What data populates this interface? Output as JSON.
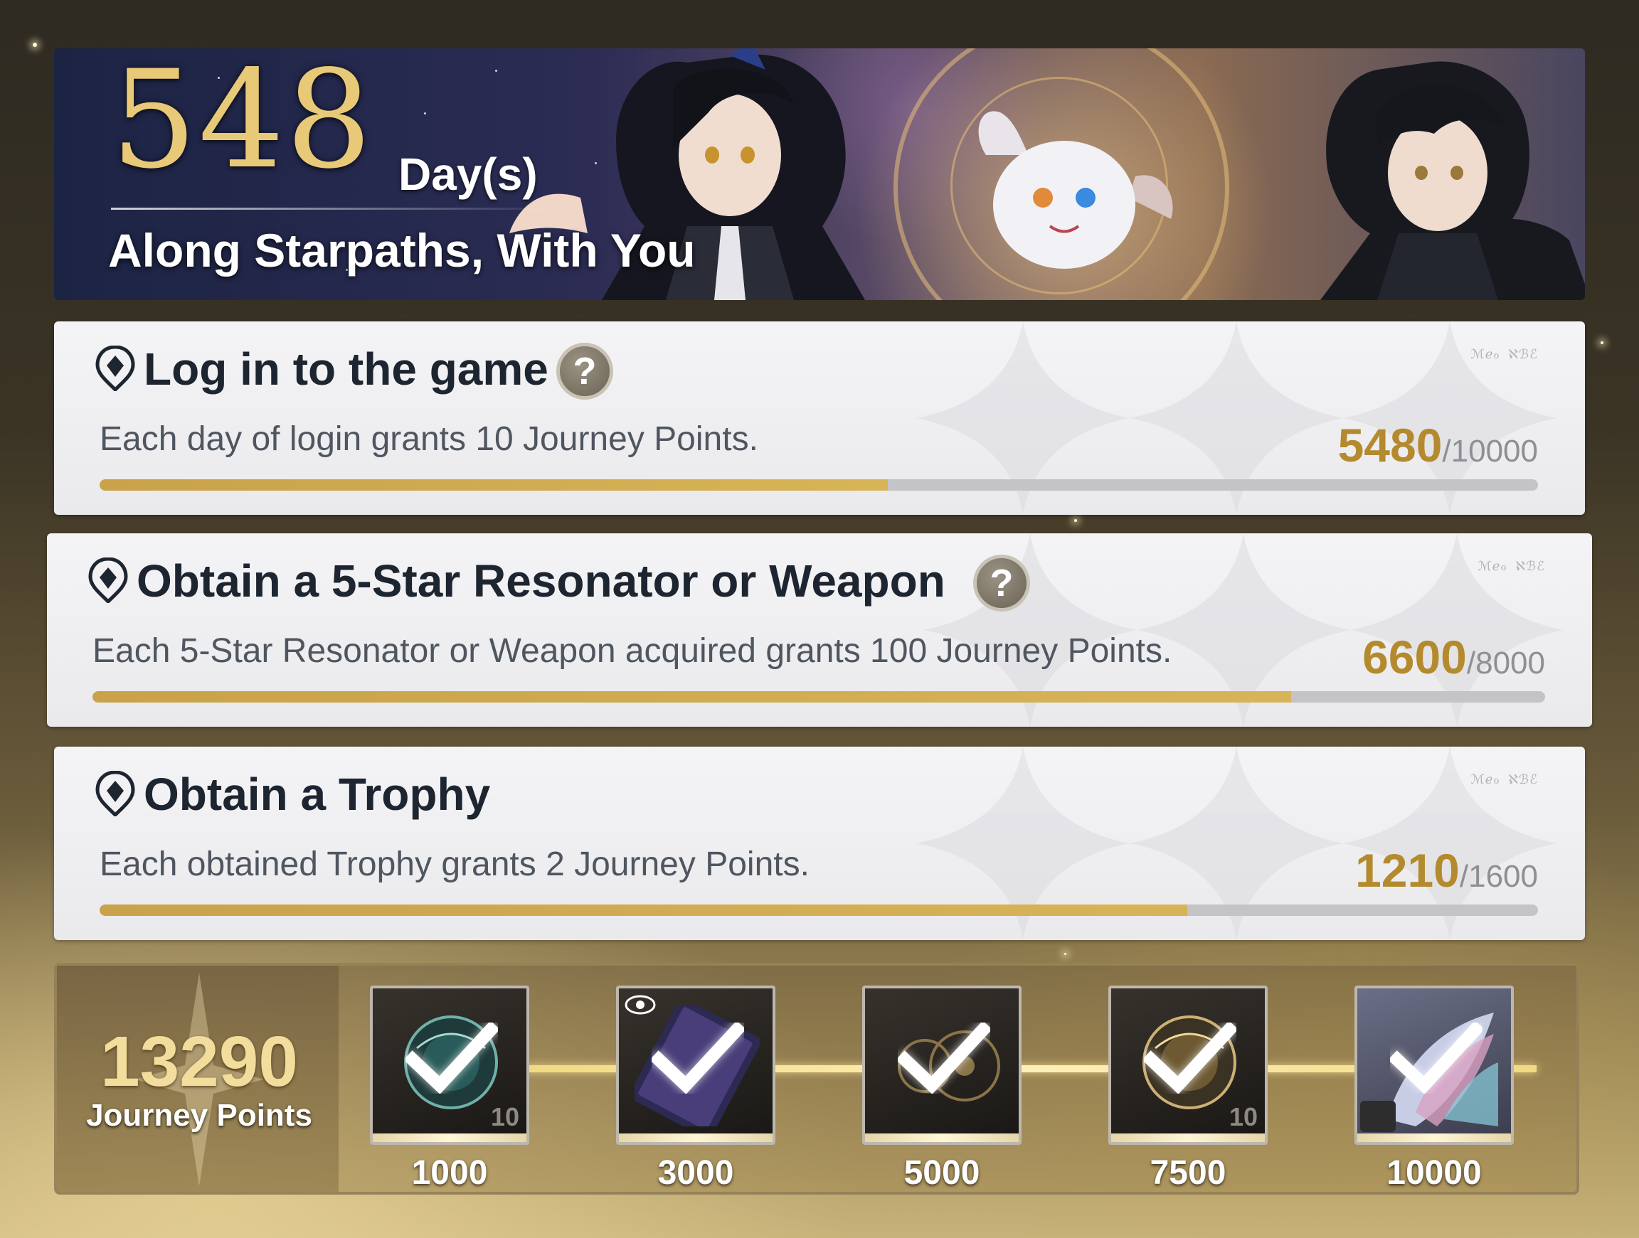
{
  "banner": {
    "days_number": "548",
    "days_unit": "Day(s)",
    "tagline": "Along Starpaths, With You"
  },
  "tasks": [
    {
      "title": "Log in to the game",
      "has_help": true,
      "description": "Each day of login grants 10 Journey Points.",
      "current": "5480",
      "total": "/10000",
      "progress": 0.548
    },
    {
      "title": "Obtain a 5-Star Resonator or Weapon",
      "has_help": true,
      "description": "Each 5-Star Resonator or Weapon acquired grants 100 Journey Points.",
      "current": "6600",
      "total": "/8000",
      "progress": 0.825
    },
    {
      "title": "Obtain a Trophy",
      "has_help": false,
      "description": "Each obtained Trophy grants 2 Journey Points.",
      "current": "1210",
      "total": "/1600",
      "progress": 0.756
    }
  ],
  "rewards": {
    "total_points": "13290",
    "total_label": "Journey Points",
    "milestones": [
      {
        "threshold": "1000",
        "qty": "10",
        "claimed": true,
        "icon": "astrite-orb-icon"
      },
      {
        "threshold": "3000",
        "qty": "",
        "claimed": true,
        "icon": "namecard-icon"
      },
      {
        "threshold": "5000",
        "qty": "",
        "claimed": true,
        "icon": "eclipse-emblem-icon"
      },
      {
        "threshold": "7500",
        "qty": "10",
        "claimed": true,
        "icon": "golden-orb-icon"
      },
      {
        "threshold": "10000",
        "qty": "",
        "claimed": true,
        "icon": "wing-decoration-icon"
      }
    ]
  },
  "colors": {
    "accent_gold": "#b48a2e",
    "progress_fill": "#d0ab50",
    "progress_track": "#c4c4c6",
    "title_text": "#1d2530"
  }
}
